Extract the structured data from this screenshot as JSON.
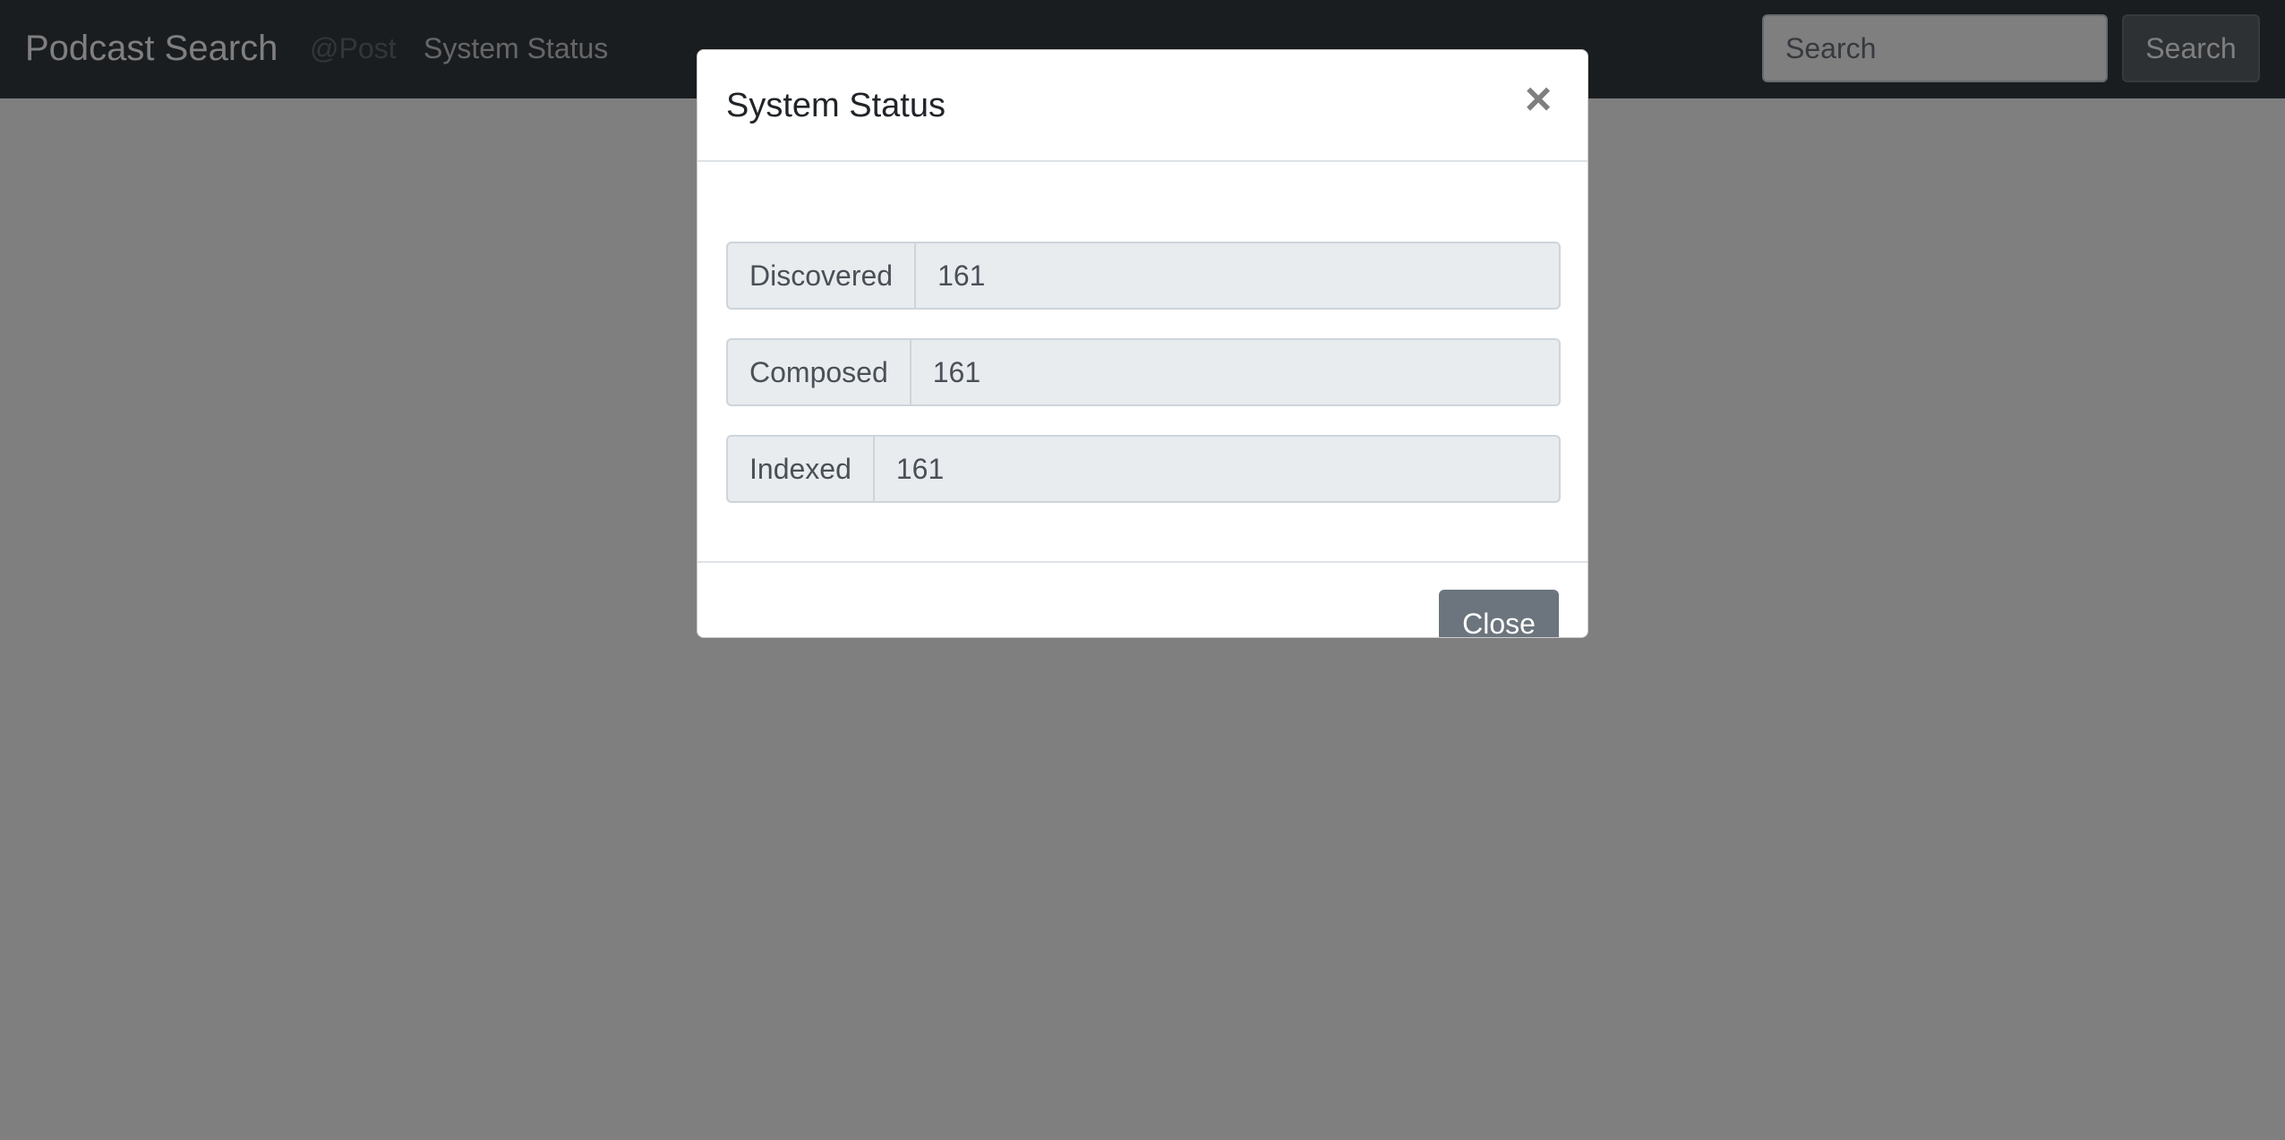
{
  "navbar": {
    "brand": "Podcast Search",
    "links": [
      "@Post",
      "System Status"
    ],
    "search_placeholder": "Search",
    "search_button": "Search"
  },
  "modal": {
    "title": "System Status",
    "close_symbol": "×",
    "rows": [
      {
        "label": "Discovered",
        "value": "161"
      },
      {
        "label": "Composed",
        "value": "161"
      },
      {
        "label": "Indexed",
        "value": "161"
      }
    ],
    "close_button": "Close"
  }
}
